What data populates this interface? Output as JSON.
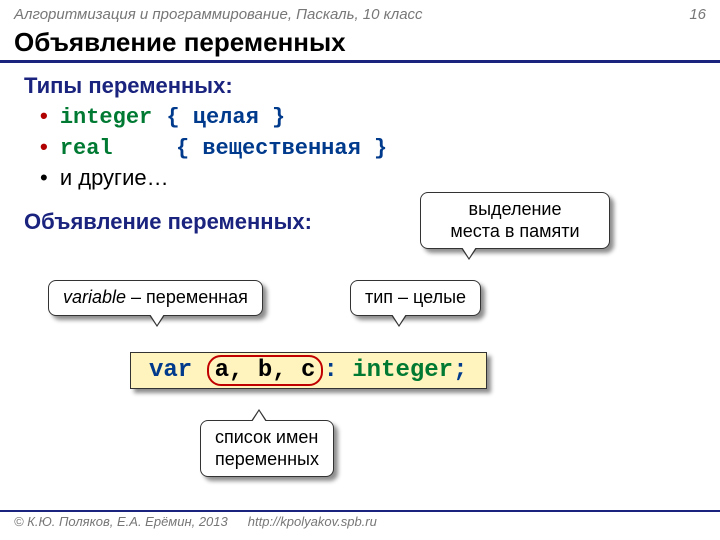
{
  "header": {
    "course": "Алгоритмизация и программирование, Паскаль, 10 класс",
    "page": "16"
  },
  "title": "Объявление переменных",
  "types": {
    "heading": "Типы переменных:",
    "rows": [
      {
        "kw": "integer",
        "comment": "{ целая }"
      },
      {
        "kw": "real",
        "comment": "{ вещественная }"
      }
    ],
    "others": "и другие…"
  },
  "decl": {
    "heading": "Объявление переменных:"
  },
  "callouts": {
    "mem1": "выделение",
    "mem2": "места в памяти",
    "var_en": "variable",
    "var_ru": " – переменная",
    "type": "тип – целые",
    "list1": "список имен",
    "list2": "переменных"
  },
  "code": {
    "var": "var",
    "names": "a, b, c",
    "colon": ":",
    "type": "integer",
    "semi": ";"
  },
  "footer": {
    "copy": "© К.Ю. Поляков, Е.А. Ерёмин, 2013",
    "url": "http://kpolyakov.spb.ru"
  }
}
